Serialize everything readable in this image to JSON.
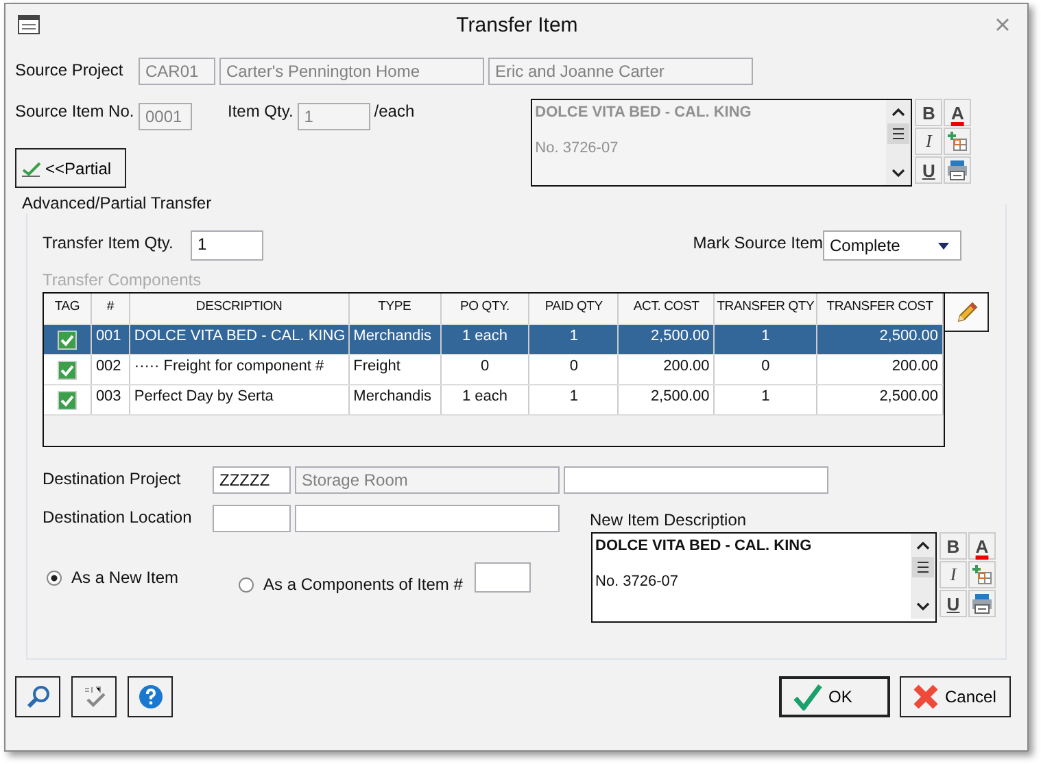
{
  "window": {
    "title": "Transfer Item"
  },
  "source": {
    "project_label": "Source Project",
    "project_code": "CAR01",
    "project_name": "Carter's Pennington Home",
    "client": "Eric and Joanne Carter",
    "item_no_label": "Source Item No.",
    "item_no": "0001",
    "qty_label": "Item Qty.",
    "qty": "1",
    "unit": "/each",
    "memo": {
      "disabled": true,
      "lines": [
        {
          "text": "DOLCE VITA BED - CAL. KING",
          "bold": true
        },
        {
          "text": "No. 3726-07",
          "bold": false
        }
      ],
      "toolbar": [
        {
          "kind": "bold",
          "label": "B"
        },
        {
          "kind": "font-color",
          "label": "A"
        },
        {
          "kind": "italic",
          "label": "I"
        },
        {
          "kind": "insert-table"
        },
        {
          "kind": "underline",
          "label": "U"
        },
        {
          "kind": "print"
        }
      ]
    }
  },
  "partial_button": "<<Partial",
  "advanced": {
    "title": "Advanced/Partial Transfer",
    "transfer_qty_label": "Transfer Item Qty.",
    "transfer_qty": "1",
    "mark_label": "Mark Source Item",
    "mark_value": "Complete",
    "components_label": "Transfer Components"
  },
  "table": {
    "columns": [
      "TAG",
      "#",
      "DESCRIPTION",
      "TYPE",
      "PO QTY.",
      "PAID QTY",
      "ACT. COST",
      "TRANSFER QTY",
      "TRANSFER COST"
    ],
    "rows": [
      {
        "tag": true,
        "selected": true,
        "cells": [
          "",
          "001",
          "DOLCE VITA BED - CAL. KING",
          "Merchandis",
          "1 each",
          "1",
          "2,500.00",
          "1",
          "2,500.00"
        ]
      },
      {
        "tag": true,
        "selected": false,
        "cells": [
          "",
          "002",
          "····· Freight for component #",
          "Freight",
          "0",
          "0",
          "200.00",
          "0",
          "200.00"
        ]
      },
      {
        "tag": true,
        "selected": false,
        "cells": [
          "",
          "003",
          "Perfect Day by Serta",
          "Merchandis",
          "1 each",
          "1",
          "2,500.00",
          "1",
          "2,500.00"
        ]
      }
    ]
  },
  "destination": {
    "project_label": "Destination Project",
    "project_code": "ZZZZZ",
    "project_name": "Storage Room",
    "location_label": "Destination Location",
    "description_label": "New Item Description",
    "memo": {
      "disabled": false,
      "lines": [
        {
          "text": "DOLCE VITA BED - CAL. KING",
          "bold": true
        },
        {
          "text": "No. 3726-07",
          "bold": false
        }
      ],
      "toolbar": [
        {
          "kind": "bold",
          "label": "B"
        },
        {
          "kind": "font-color",
          "label": "A"
        },
        {
          "kind": "italic",
          "label": "I"
        },
        {
          "kind": "insert-table"
        },
        {
          "kind": "underline",
          "label": "U"
        },
        {
          "kind": "print"
        }
      ]
    }
  },
  "options": [
    {
      "label": "As a New Item",
      "selected": true
    },
    {
      "label": "As a Components of Item #",
      "selected": false
    }
  ],
  "buttons": [
    {
      "kind": "ok",
      "label": "OK"
    },
    {
      "kind": "cancel",
      "label": "Cancel"
    }
  ]
}
